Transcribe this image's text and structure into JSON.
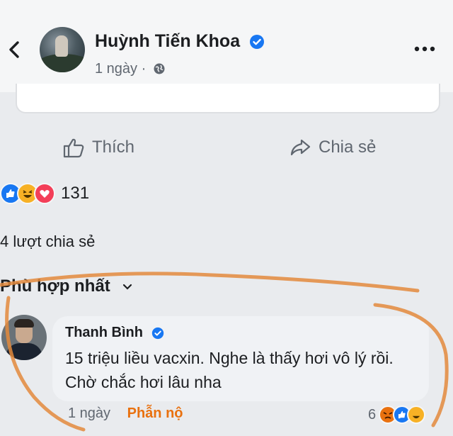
{
  "post": {
    "author": "Huỳnh Tiến Khoa",
    "time": "1 ngày ·",
    "actions": {
      "like": "Thích",
      "share": "Chia sẻ"
    },
    "reaction_count": "131",
    "share_count": "4 lượt chia sẻ",
    "comment_sort": "Phù hợp nhất"
  },
  "comment": {
    "author": "Thanh Bình",
    "text": "15 triệu liều vacxin. Nghe là thấy hơi vô lý rồi. Chờ chắc hơi lâu nha",
    "time": "1 ngày",
    "reaction_label": "Phẫn nộ",
    "reaction_count": "6"
  },
  "icons": {
    "back": "back-arrow-icon",
    "verified": "verified-badge-icon",
    "privacy": "globe-icon",
    "more": "more-options-icon",
    "like": "thumbs-up-icon",
    "share": "share-arrow-icon",
    "sort": "chevron-down-icon"
  },
  "colors": {
    "verified": "#1877f2",
    "like_reaction": "#1877f2",
    "haha_reaction": "#f7b125",
    "love_reaction": "#f33e58",
    "angry_reaction": "#e9710f",
    "annotation": "#e38a3c"
  }
}
